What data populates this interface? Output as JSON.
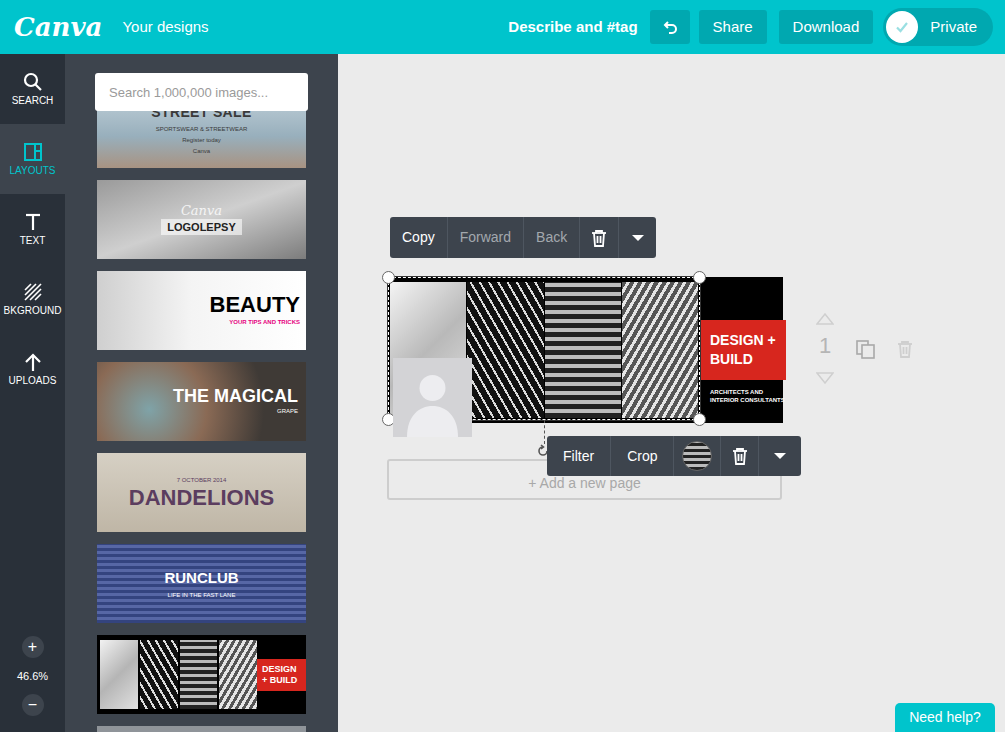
{
  "topbar": {
    "logo": "Canva",
    "your_designs": "Your designs",
    "describe": "Describe and #tag",
    "buttons": [
      {
        "label": "Share"
      },
      {
        "label": "Download"
      }
    ],
    "privacy": {
      "label": "Private",
      "on": true
    }
  },
  "sidebar": {
    "items": [
      {
        "label": "SEARCH",
        "selected": false
      },
      {
        "label": "LAYOUTS",
        "selected": true
      },
      {
        "label": "TEXT",
        "selected": false
      },
      {
        "label": "BKGROUND",
        "selected": false
      },
      {
        "label": "UPLOADS",
        "selected": false
      }
    ],
    "zoom": {
      "in": "+",
      "value": "46.6%",
      "out": "−"
    }
  },
  "panel": {
    "search": {
      "placeholder": "Search 1,000,000 images..."
    },
    "layouts": [
      {
        "kind": "banner",
        "top": [],
        "title": "STREET SALE",
        "bottom": [
          "SPORTSWEAR & STREETWEAR",
          "Register today",
          "Canva"
        ]
      },
      {
        "kind": "banner",
        "top": [
          "Canva"
        ],
        "title": "LOGOLEPSY",
        "bottom": []
      },
      {
        "kind": "banner",
        "top": [],
        "title": "BEAUTY",
        "bottom": [
          "YOUR TIPS AND TRICKS"
        ]
      },
      {
        "kind": "banner",
        "top": [],
        "title": "THE MAGICAL",
        "bottom": [
          "GRAPE"
        ]
      },
      {
        "kind": "banner",
        "top": [
          "7 OCTOBER 2014"
        ],
        "title": "DANDELIONS",
        "bottom": []
      },
      {
        "kind": "banner",
        "top": [],
        "title": "RUNCLUB",
        "bottom": [
          "LIFE IN THE FAST LANE"
        ]
      },
      {
        "kind": "split",
        "top": [],
        "title": "DESIGN + BUILD",
        "bottom": []
      },
      {
        "kind": "banner",
        "top": [],
        "title": "",
        "bottom": []
      }
    ]
  },
  "canvas": {
    "element_toolbar": {
      "items": [
        {
          "label": "Copy",
          "disabled": false
        },
        {
          "label": "Forward",
          "disabled": true
        },
        {
          "label": "Back",
          "disabled": true
        }
      ]
    },
    "image_toolbar": {
      "items": [
        {
          "label": "Filter"
        },
        {
          "label": "Crop"
        }
      ]
    },
    "page": {
      "title": [
        "DESIGN +",
        "BUILD"
      ],
      "subtitle": [
        "ARCHITECTS AND",
        "INTERIOR CONSULTANTS"
      ]
    },
    "add_page": "+ Add a new page",
    "page_number": "1"
  },
  "help": {
    "label": "Need help?"
  }
}
